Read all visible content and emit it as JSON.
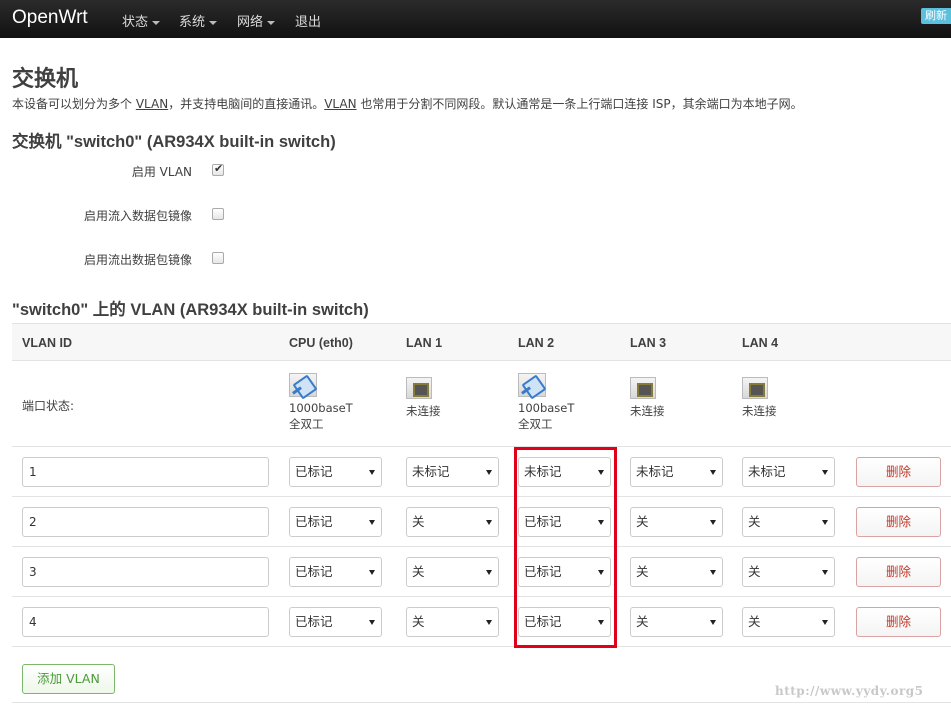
{
  "navbar": {
    "brand": "OpenWrt",
    "menu": [
      {
        "label": "状态",
        "dropdown": true
      },
      {
        "label": "系统",
        "dropdown": true
      },
      {
        "label": "网络",
        "dropdown": true
      },
      {
        "label": "退出",
        "dropdown": false
      }
    ],
    "refresh_label": "刷新"
  },
  "page": {
    "title": "交换机",
    "desc_1": "本设备可以划分为多个 ",
    "desc_vlan_1": "VLAN",
    "desc_2": "，并支持电脑间的直接通讯。",
    "desc_vlan_2": "VLAN",
    "desc_3": " 也常用于分割不同网段。默认通常是一条上行端口连接 ISP，其余端口为本地子网。"
  },
  "switch_section": {
    "title": "交换机 \"switch0\" (AR934X built-in switch)",
    "options": [
      {
        "label": "启用 VLAN",
        "checked": true
      },
      {
        "label": "启用流入数据包镜像",
        "checked": false
      },
      {
        "label": "启用流出数据包镜像",
        "checked": false
      }
    ]
  },
  "vlan_section": {
    "title": "\"switch0\" 上的 VLAN (AR934X built-in switch)",
    "headers": [
      "VLAN ID",
      "CPU (eth0)",
      "LAN 1",
      "LAN 2",
      "LAN 3",
      "LAN 4"
    ],
    "port_status_label": "端口状态:",
    "ports": [
      {
        "icon": "ethernet-connected-icon",
        "line1": "1000baseT",
        "line2": "全双工"
      },
      {
        "icon": "ethernet-disconnected-icon",
        "line1": "未连接",
        "line2": ""
      },
      {
        "icon": "ethernet-connected-icon",
        "line1": "100baseT",
        "line2": "全双工"
      },
      {
        "icon": "ethernet-disconnected-icon",
        "line1": "未连接",
        "line2": ""
      },
      {
        "icon": "ethernet-disconnected-icon",
        "line1": "未连接",
        "line2": ""
      }
    ],
    "rows": [
      {
        "id": "1",
        "cells": [
          "已标记",
          "未标记",
          "未标记",
          "未标记",
          "未标记"
        ]
      },
      {
        "id": "2",
        "cells": [
          "已标记",
          "关",
          "已标记",
          "关",
          "关"
        ]
      },
      {
        "id": "3",
        "cells": [
          "已标记",
          "关",
          "已标记",
          "关",
          "关"
        ]
      },
      {
        "id": "4",
        "cells": [
          "已标记",
          "关",
          "已标记",
          "关",
          "关"
        ]
      }
    ],
    "delete_label": "删除",
    "add_label": "添加 VLAN"
  },
  "watermark": "http://www.yydy.org5",
  "colors": {
    "navbar": "#1b1b1b",
    "highlight": "#e0001a",
    "delete": "#c0392b",
    "add": "#4c9a3a"
  }
}
